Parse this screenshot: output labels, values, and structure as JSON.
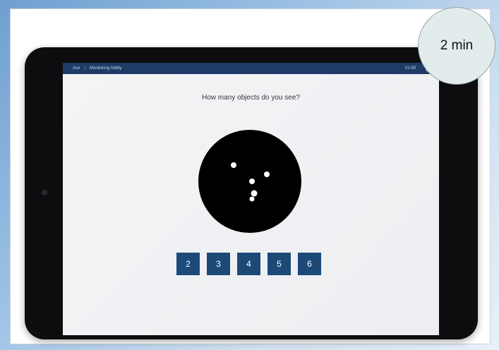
{
  "topbar": {
    "breadcrumb_root": "Ace",
    "breadcrumb_separator": "/",
    "breadcrumb_current": "Monitoring Ability",
    "timer": "01:59",
    "help_icon": "?"
  },
  "task": {
    "question": "How many objects do you see?",
    "answers": [
      "2",
      "3",
      "4",
      "5",
      "6"
    ]
  },
  "badge": {
    "duration": "2 min"
  },
  "colors": {
    "topbar": "#1d3b66",
    "button": "#1d4979",
    "stimulus_background": "#000000",
    "stimulus_dots": "#ffffff",
    "badge_fill": "#e2ecec"
  },
  "icons": {
    "help": "help-icon"
  }
}
